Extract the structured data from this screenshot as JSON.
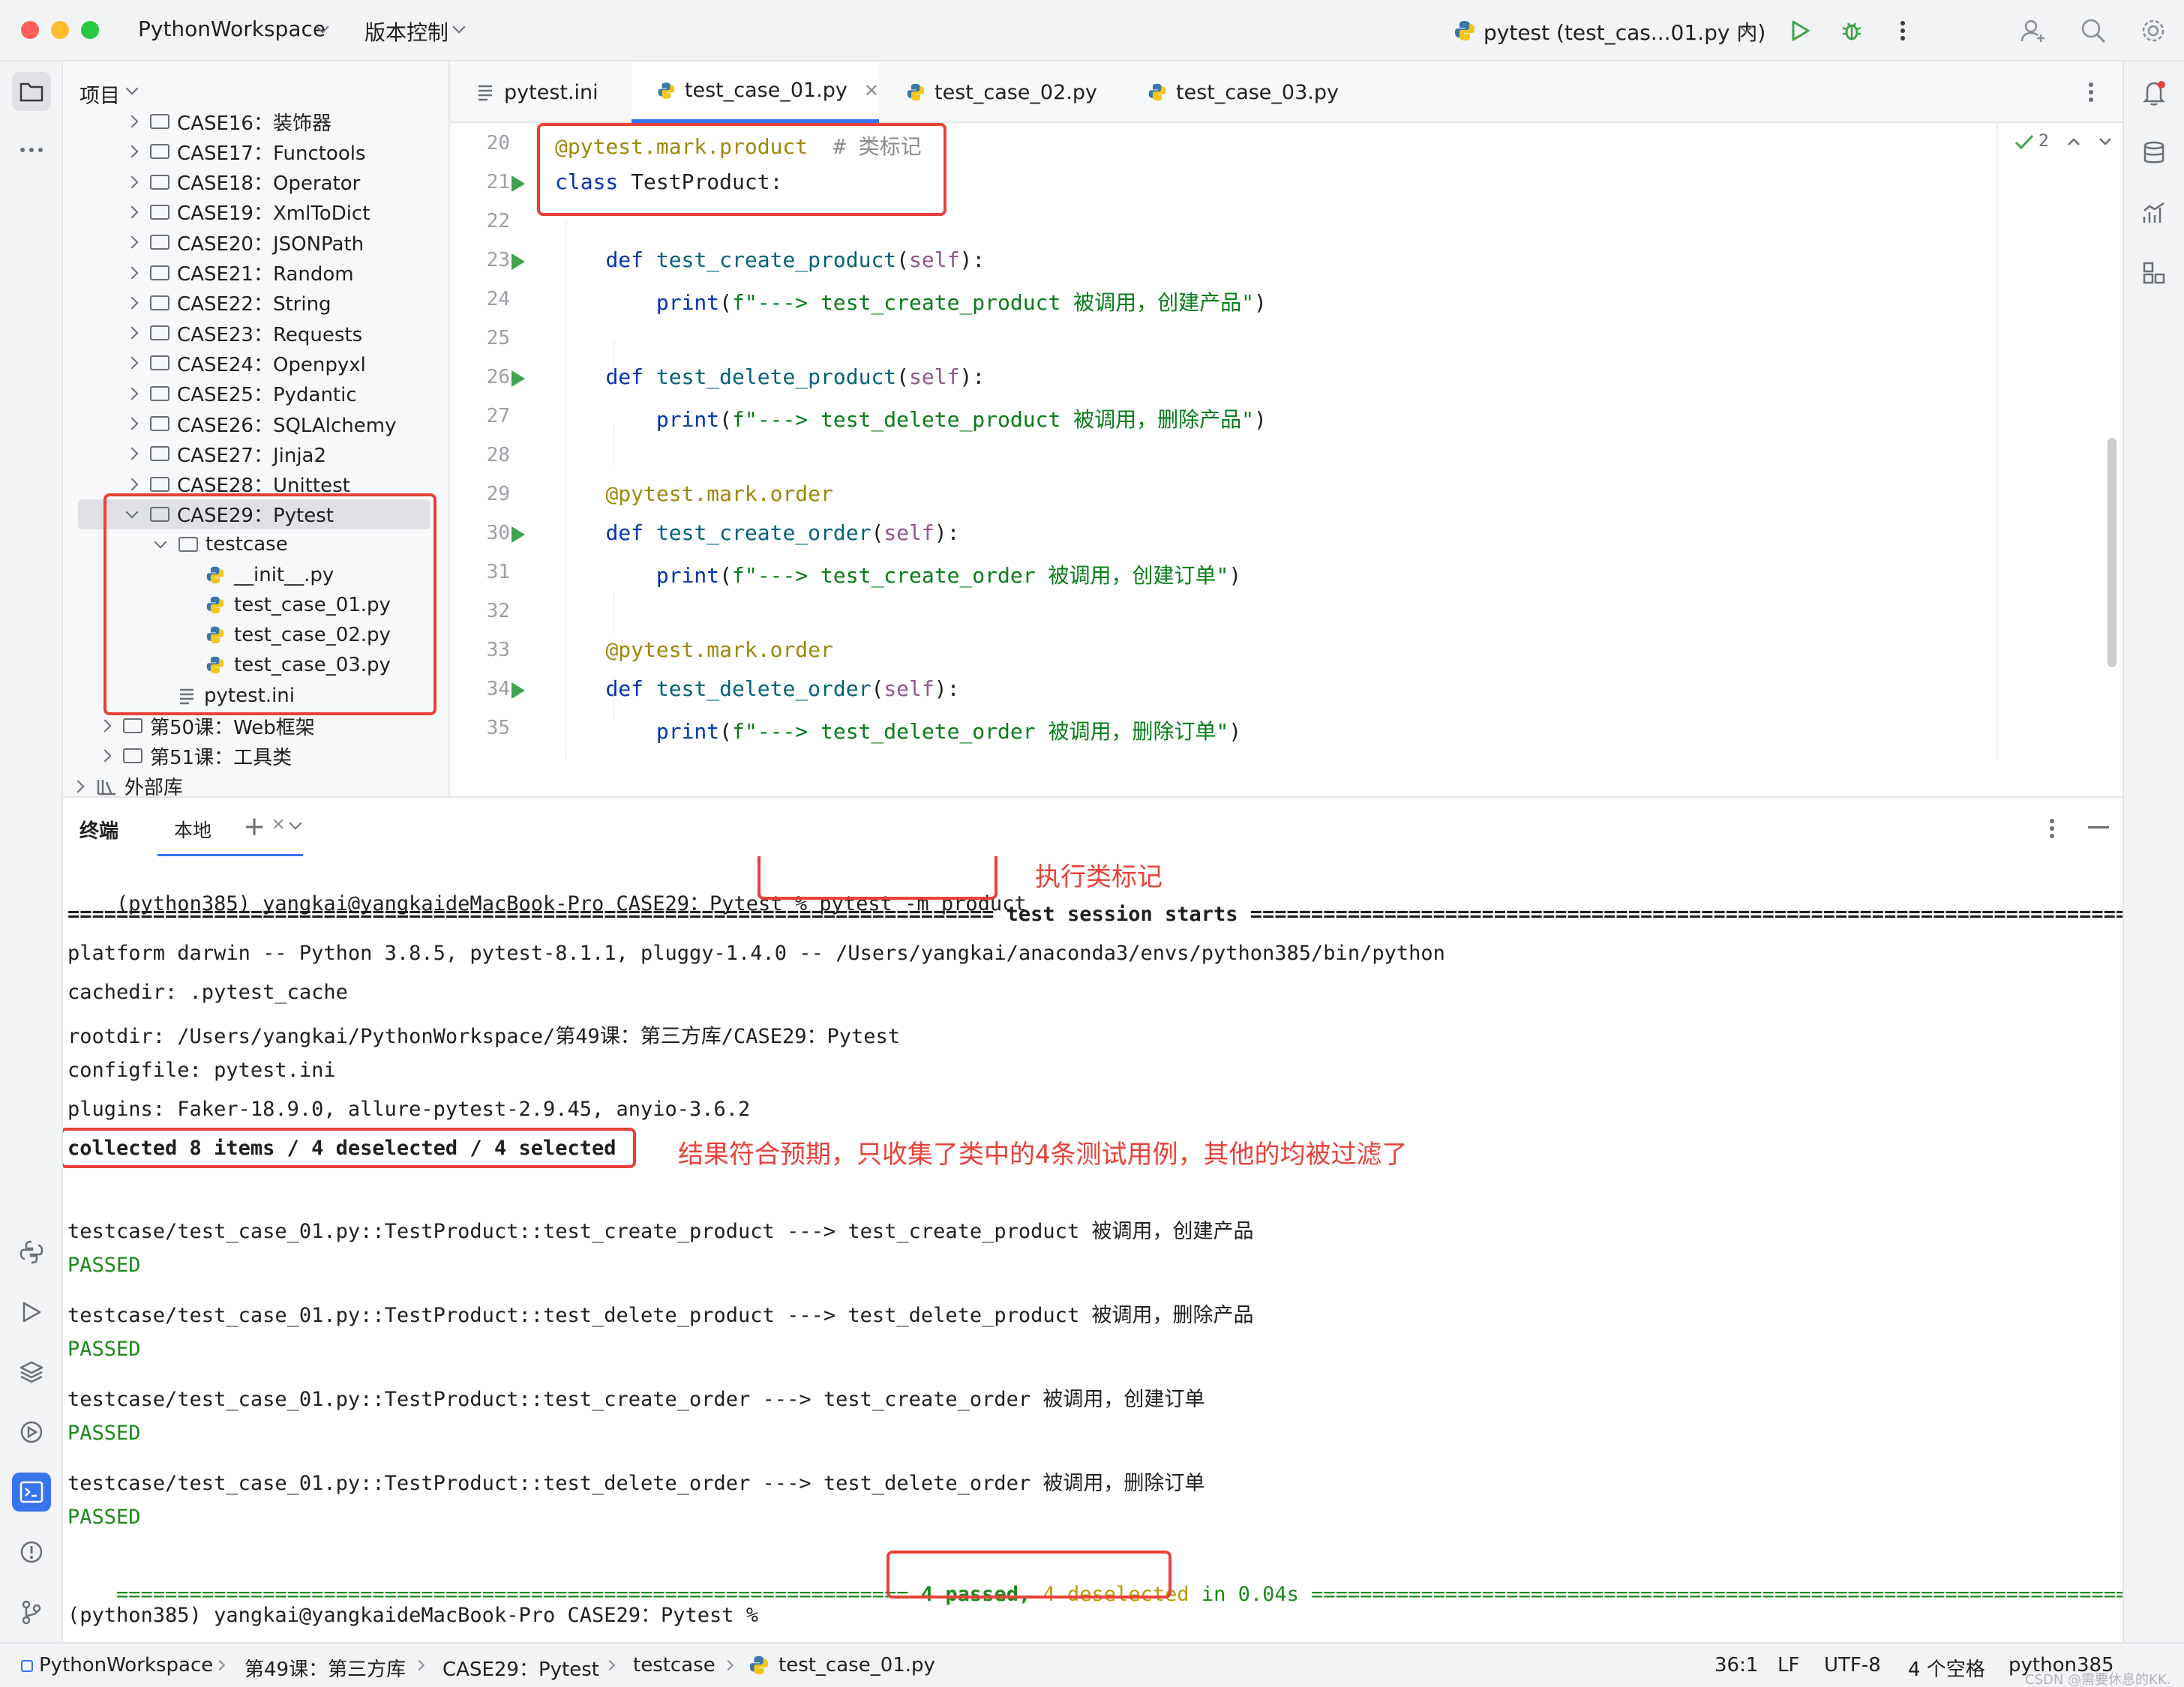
{
  "titlebar": {
    "project": "PythonWorkspace",
    "vcs": "版本控制",
    "run_config": "pytest (test_cas...01.py 内)"
  },
  "project_panel": {
    "title": "项目",
    "items": [
      {
        "label": "CASE16：装饰器",
        "kind": "folder",
        "level": 2
      },
      {
        "label": "CASE17：Functools",
        "kind": "folder",
        "level": 2
      },
      {
        "label": "CASE18：Operator",
        "kind": "folder",
        "level": 2
      },
      {
        "label": "CASE19：XmlToDict",
        "kind": "folder",
        "level": 2
      },
      {
        "label": "CASE20：JSONPath",
        "kind": "folder",
        "level": 2
      },
      {
        "label": "CASE21：Random",
        "kind": "folder",
        "level": 2
      },
      {
        "label": "CASE22：String",
        "kind": "folder",
        "level": 2
      },
      {
        "label": "CASE23：Requests",
        "kind": "folder",
        "level": 2
      },
      {
        "label": "CASE24：Openpyxl",
        "kind": "folder",
        "level": 2
      },
      {
        "label": "CASE25：Pydantic",
        "kind": "folder",
        "level": 2
      },
      {
        "label": "CASE26：SQLAlchemy",
        "kind": "folder",
        "level": 2
      },
      {
        "label": "CASE27：Jinja2",
        "kind": "folder",
        "level": 2
      },
      {
        "label": "CASE28：Unittest",
        "kind": "folder",
        "level": 2
      },
      {
        "label": "CASE29：Pytest",
        "kind": "folder-open",
        "level": 2
      },
      {
        "label": "testcase",
        "kind": "folder-open",
        "level": 3
      },
      {
        "label": "__init__.py",
        "kind": "py",
        "level": 4
      },
      {
        "label": "test_case_01.py",
        "kind": "py",
        "level": 4
      },
      {
        "label": "test_case_02.py",
        "kind": "py",
        "level": 4
      },
      {
        "label": "test_case_03.py",
        "kind": "py",
        "level": 4
      },
      {
        "label": "pytest.ini",
        "kind": "ini",
        "level": 3
      },
      {
        "label": "第50课：Web框架",
        "kind": "folder",
        "level": 1
      },
      {
        "label": "第51课：工具类",
        "kind": "folder",
        "level": 1
      },
      {
        "label": "外部库",
        "kind": "lib",
        "level": 0
      }
    ]
  },
  "tabs": [
    {
      "label": "pytest.ini"
    },
    {
      "label": "test_case_01.py"
    },
    {
      "label": "test_case_02.py"
    },
    {
      "label": "test_case_03.py"
    }
  ],
  "editor": {
    "inspection_count": "2",
    "lines": [
      {
        "num": "20",
        "text": "@pytest.mark.product  # 类标记"
      },
      {
        "num": "21",
        "text": "class TestProduct:"
      },
      {
        "num": "22",
        "text": ""
      },
      {
        "num": "23",
        "text": "    def test_create_product(self):"
      },
      {
        "num": "24",
        "text": "        print(f\"---> test_create_product 被调用，创建产品\")"
      },
      {
        "num": "25",
        "text": ""
      },
      {
        "num": "26",
        "text": "    def test_delete_product(self):"
      },
      {
        "num": "27",
        "text": "        print(f\"---> test_delete_product 被调用，删除产品\")"
      },
      {
        "num": "28",
        "text": ""
      },
      {
        "num": "29",
        "text": "    @pytest.mark.order"
      },
      {
        "num": "30",
        "text": "    def test_create_order(self):"
      },
      {
        "num": "31",
        "text": "        print(f\"---> test_create_order 被调用，创建订单\")"
      },
      {
        "num": "32",
        "text": ""
      },
      {
        "num": "33",
        "text": "    @pytest.mark.order"
      },
      {
        "num": "34",
        "text": "    def test_delete_order(self):"
      },
      {
        "num": "35",
        "text": "        print(f\"---> test_delete_order 被调用，删除订单\")"
      }
    ]
  },
  "terminal": {
    "title": "终端",
    "tab": "本地",
    "prompt": "(python385) yangkai@yangkaideMacBook-Pro CASE29：Pytest %",
    "command": "pytest -m product",
    "annotation_command": "执行类标记",
    "session_line": "============================================================================ test session starts =============================================================================",
    "platform": "platform darwin -- Python 3.8.5, pytest-8.1.1, pluggy-1.4.0 -- /Users/yangkai/anaconda3/envs/python385/bin/python",
    "cachedir": "cachedir: .pytest_cache",
    "rootdir": "rootdir: /Users/yangkai/PythonWorkspace/第49课：第三方库/CASE29：Pytest",
    "configfile": "configfile: pytest.ini",
    "plugins": "plugins: Faker-18.9.0, allure-pytest-2.9.45, anyio-3.6.2",
    "collected": "collected 8 items / 4 deselected / 4 selected",
    "annotation_collected": "结果符合预期，只收集了类中的4条测试用例，其他的均被过滤了",
    "results": [
      {
        "line": "testcase/test_case_01.py::TestProduct::test_create_product ---> test_create_product 被调用，创建产品",
        "status": "PASSED"
      },
      {
        "line": "testcase/test_case_01.py::TestProduct::test_delete_product ---> test_delete_product 被调用，删除产品",
        "status": "PASSED"
      },
      {
        "line": "testcase/test_case_01.py::TestProduct::test_create_order ---> test_create_order 被调用，创建订单",
        "status": "PASSED"
      },
      {
        "line": "testcase/test_case_01.py::TestProduct::test_delete_order ---> test_delete_order 被调用，删除订单",
        "status": "PASSED"
      }
    ],
    "summary_left": "=================================================================",
    "summary_passed": "4 passed,",
    "summary_deselected": "4 deselected",
    "summary_time": "in 0.04s",
    "summary_right": "=========================================================================",
    "final_prompt": "(python385) yangkai@yangkaideMacBook-Pro CASE29：Pytest %"
  },
  "statusbar": {
    "breadcrumb": [
      "PythonWorkspace",
      "第49课：第三方库",
      "CASE29：Pytest",
      "testcase",
      "test_case_01.py"
    ],
    "position": "36:1",
    "line_sep": "LF",
    "encoding": "UTF-8",
    "indent": "4 个空格",
    "interpreter": "python385",
    "watermark": "CSDN @需要休息的KK."
  },
  "colors": {
    "accent": "#3874f0",
    "annotation": "#e8413a",
    "passed": "#1a8a1a",
    "run": "#3fa34d"
  }
}
